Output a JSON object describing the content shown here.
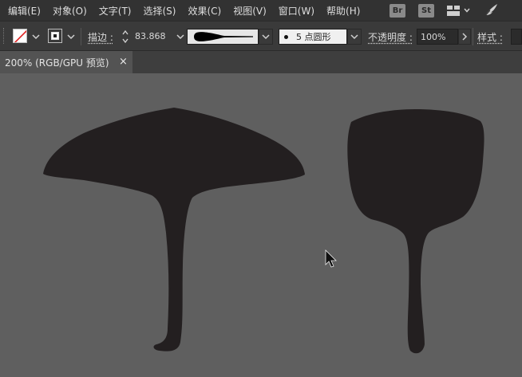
{
  "menubar": {
    "items": [
      "编辑(E)",
      "对象(O)",
      "文字(T)",
      "选择(S)",
      "效果(C)",
      "视图(V)",
      "窗口(W)",
      "帮助(H)"
    ],
    "bridge_badge": "Br",
    "stock_badge": "St",
    "icons": [
      "workspace-switcher-icon",
      "chevron-down-icon",
      "feather-icon"
    ]
  },
  "controlbar": {
    "stroke_label": "描边 :",
    "stroke_weight": "83.868",
    "brush_label": "5 点圆形",
    "opacity_label": "不透明度 :",
    "opacity_value": "100%",
    "style_label": "样式 :"
  },
  "document": {
    "tab_title": "200% (RGB/GPU 预览)",
    "close_glyph": "×"
  },
  "colors": {
    "menubar_bg": "#323232",
    "controlbar_bg": "#3a3a3a",
    "canvas_bg": "#5f5f5f",
    "shape_fill": "#231f20"
  }
}
